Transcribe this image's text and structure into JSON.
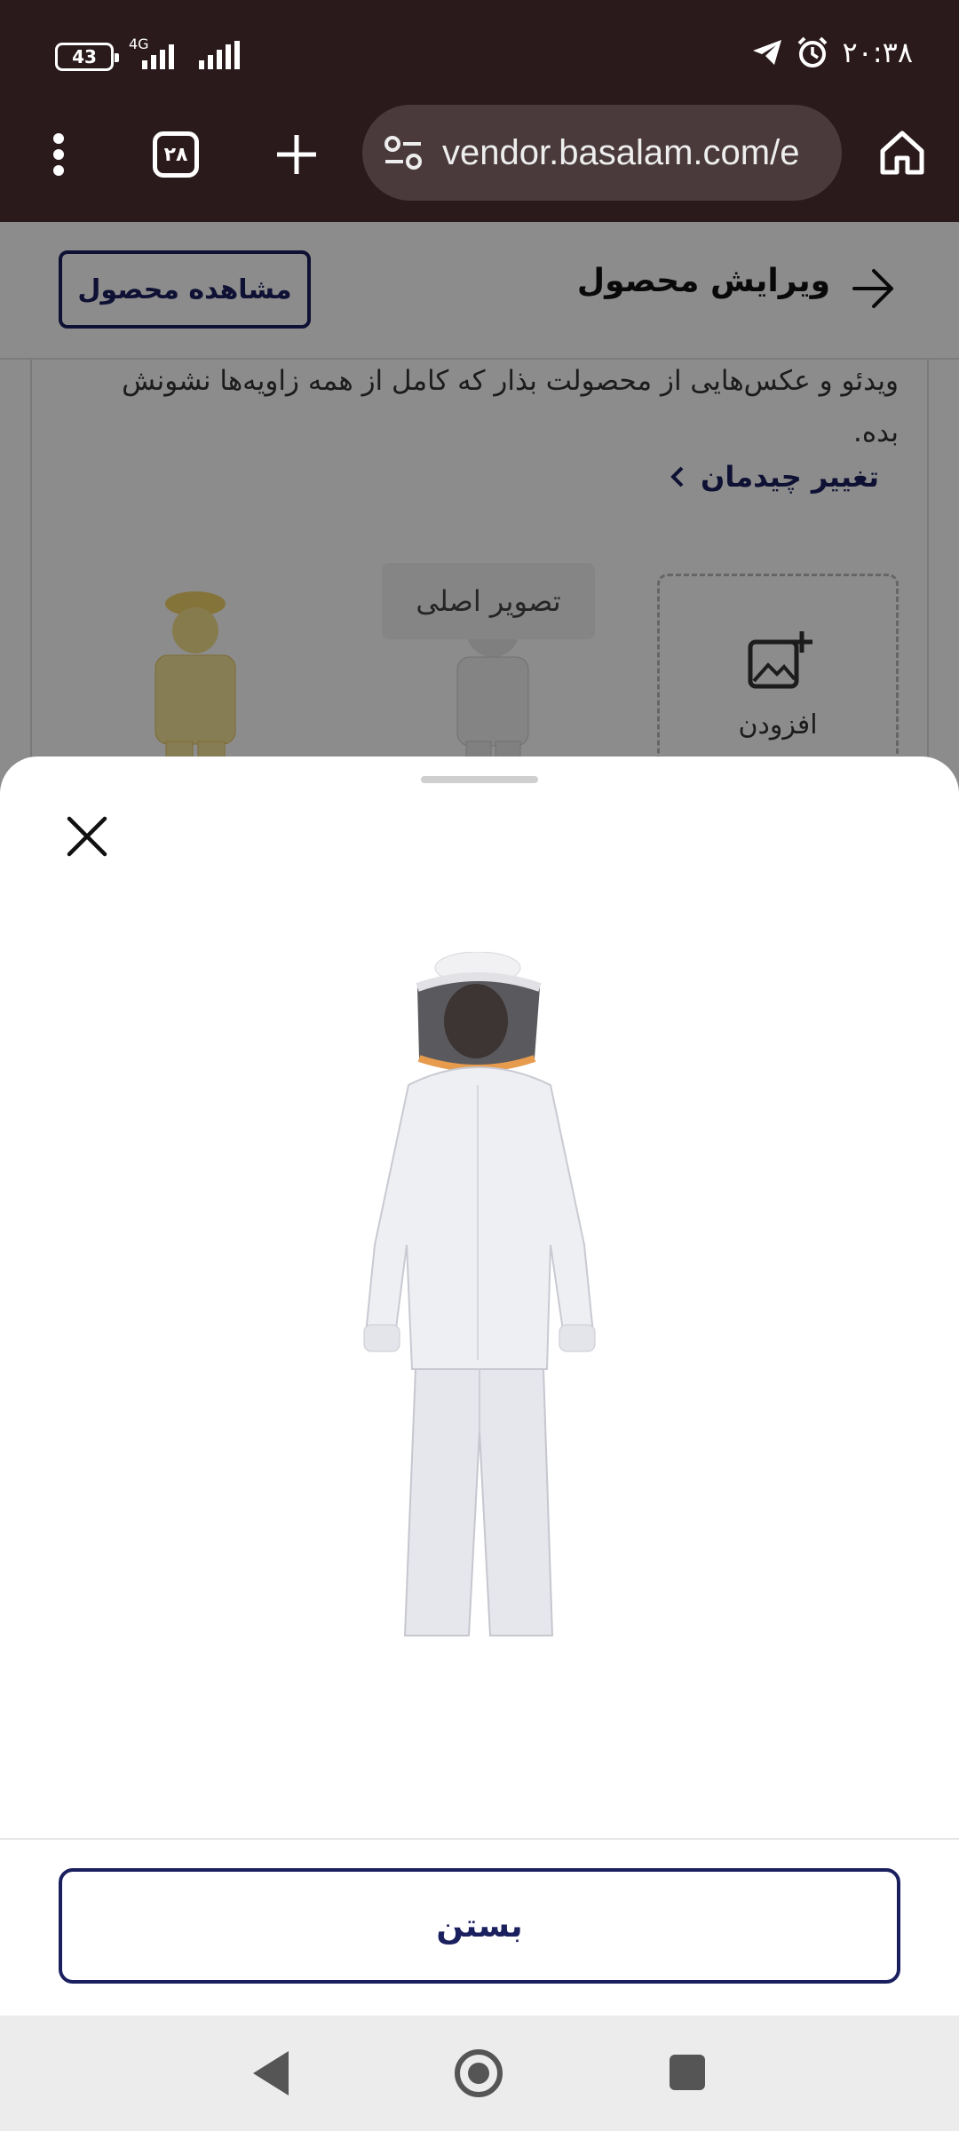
{
  "status_bar": {
    "battery": "43",
    "network_type": "4G",
    "time": "۲۰:۳۸"
  },
  "browser": {
    "tab_count": "۲۸",
    "url": "vendor.basalam.com/e"
  },
  "page": {
    "header_title": "ویرایش محصول",
    "view_product_label": "مشاهده محصول",
    "description": "ویدئو و عکس‌هایی از محصولت بذار که کامل از همه زاویه‌ها نشونش بده.",
    "change_layout_label": "تغییر چیدمان",
    "main_image_tag": "تصویر اصلی",
    "add_label": "افزودن"
  },
  "sheet": {
    "close_label": "بستن"
  },
  "colors": {
    "brand_navy": "#1a1f5e",
    "browser_bar": "#2b1a1c"
  }
}
